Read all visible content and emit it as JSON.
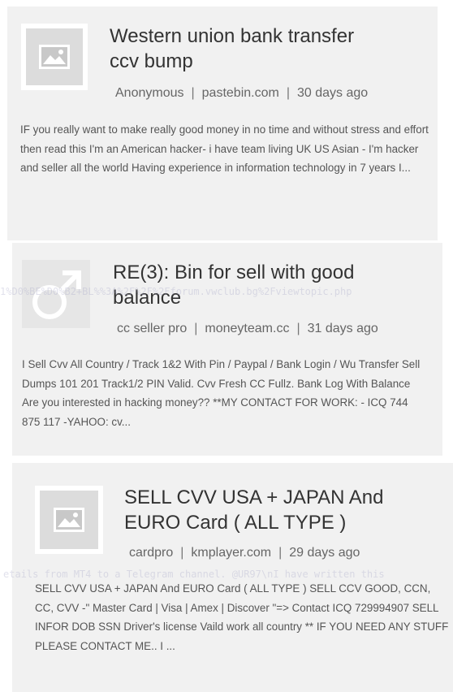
{
  "results": [
    {
      "title": "Western union bank transfer ccv bump",
      "author": "Anonymous",
      "source": "pastebin.com",
      "age": "30 days ago",
      "snippet": "IF you really want to make really good money in no time and without stress and effort then read this I'm an American hacker- i have team living UK US Asian - I'm hacker and seller all the world Having experience in information technology in 7 years I...",
      "thumbnail_icon": "image-placeholder-icon"
    },
    {
      "title": "RE(3): Bin for sell with good balance",
      "author": "cc seller pro",
      "source": "moneyteam.cc",
      "age": "31 days ago",
      "snippet": "I Sell Cvv All Country / Track 1&2 With Pin / Paypal / Bank Login / Wu Transfer Sell Dumps 101 201 Track1/2 PIN Valid. Cvv Fresh CC Fullz. Bank Log With Balance Are you interested in hacking money?? **MY CONTACT FOR WORK: - ICQ 744 875 117 -YAHOO: cv...",
      "thumbnail_icon": "male-symbol-icon",
      "overlay_text": "1%D0%BE%D0%B2+BL%%3A%2F%2F%2Fforum.vwclub.bg%2Fviewtopic.php"
    },
    {
      "title": "SELL CVV USA + JAPAN And EURO Card ( ALL TYPE )",
      "author": "cardpro",
      "source": "kmplayer.com",
      "age": "29 days ago",
      "snippet": "SELL CVV USA + JAPAN And EURO Card ( ALL TYPE ) SELL CCV GOOD, CCN, CC, CVV -\" Master Card | Visa | Amex | Discover \"=> Contact ICQ 729994907 SELL INFOR DOB SSN Driver's license Vaild work all country ** IF YOU NEED ANY STUFF PLEASE CONTACT ME.. I ...",
      "thumbnail_icon": "image-placeholder-icon",
      "overlay_text": "etails from MT4 to a Telegram channel. @UR97\\nI have written this"
    }
  ],
  "separator": "|",
  "colors": {
    "card_bg": "#f1f1f1",
    "title": "#333333",
    "meta": "#666666",
    "snippet": "#555555",
    "placeholder": "#dcdcdc"
  }
}
